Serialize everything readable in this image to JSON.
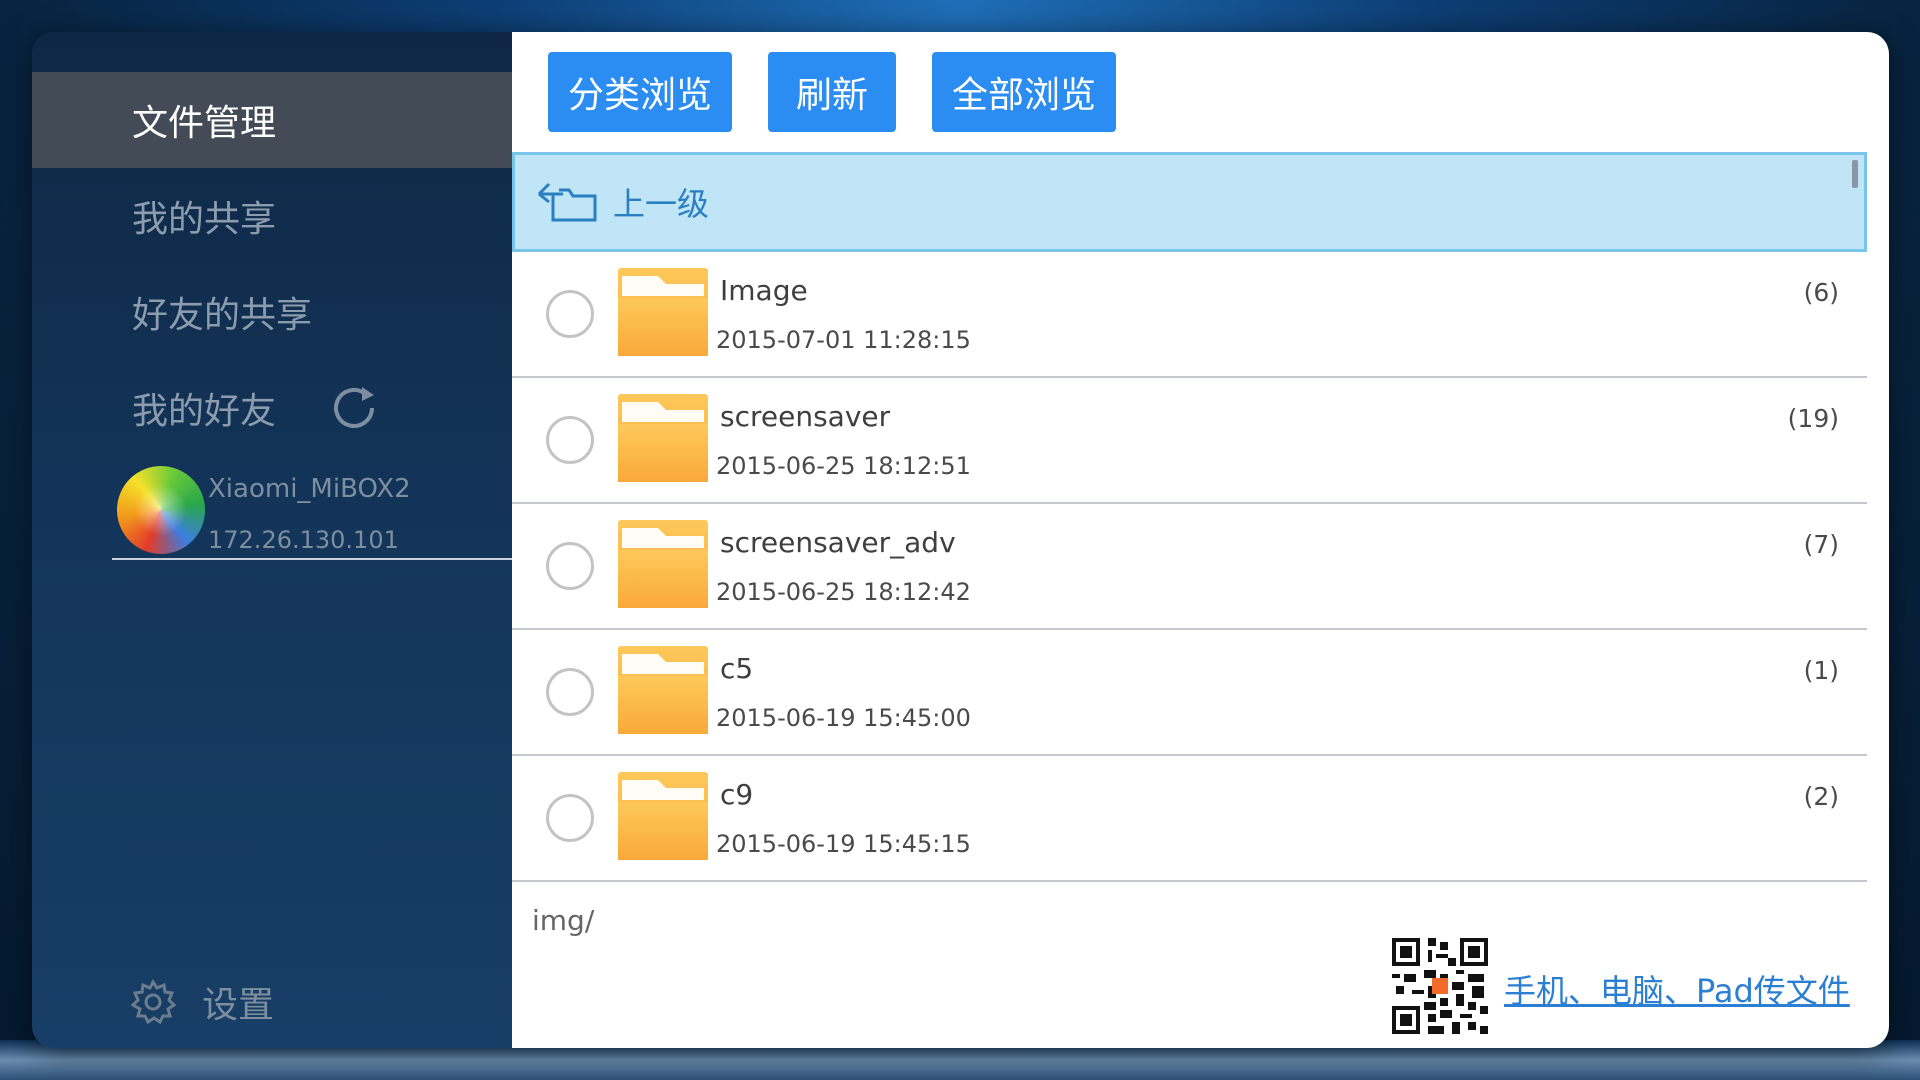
{
  "sidebar": {
    "items": [
      {
        "label": "文件管理",
        "active": true
      },
      {
        "label": "我的共享",
        "active": false
      },
      {
        "label": "好友的共享",
        "active": false
      },
      {
        "label": "我的好友",
        "active": false
      }
    ],
    "device": {
      "name": "Xiaomi_MiBOX2",
      "ip": "172.26.130.101"
    },
    "settings_label": "设置"
  },
  "toolbar": {
    "category_label": "分类浏览",
    "refresh_label": "刷新",
    "all_label": "全部浏览"
  },
  "up_level_label": "上一级",
  "files": [
    {
      "name": "Image",
      "date": "2015-07-01 11:28:15",
      "count": "(6)"
    },
    {
      "name": "screensaver",
      "date": "2015-06-25 18:12:51",
      "count": "(19)"
    },
    {
      "name": "screensaver_adv",
      "date": "2015-06-25 18:12:42",
      "count": "(7)"
    },
    {
      "name": "c5",
      "date": "2015-06-19 15:45:00",
      "count": "(1)"
    },
    {
      "name": "c9",
      "date": "2015-06-19 15:45:15",
      "count": "(2)"
    }
  ],
  "path": "img/",
  "promo_link": "手机、电脑、Pad传文件",
  "colors": {
    "accent": "#2b8df2",
    "selected_row": "#bfe5f7",
    "sidebar_active": "#424b56",
    "folder": "#fbb843"
  }
}
